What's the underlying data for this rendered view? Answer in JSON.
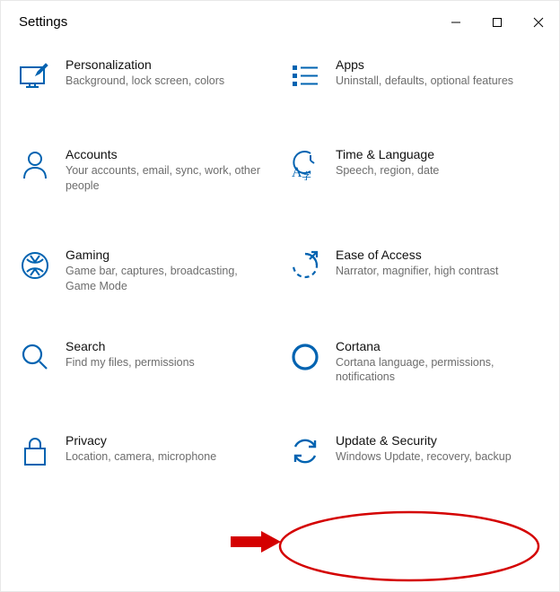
{
  "window": {
    "title": "Settings"
  },
  "colors": {
    "accent": "#0063B1",
    "annotation": "#d40000"
  },
  "tiles": [
    {
      "key": "personalization",
      "icon": "personalization-icon",
      "title": "Personalization",
      "desc": "Background, lock screen, colors"
    },
    {
      "key": "apps",
      "icon": "apps-icon",
      "title": "Apps",
      "desc": "Uninstall, defaults, optional features"
    },
    {
      "key": "accounts",
      "icon": "accounts-icon",
      "title": "Accounts",
      "desc": "Your accounts, email, sync, work, other people"
    },
    {
      "key": "time-language",
      "icon": "time-language-icon",
      "title": "Time & Language",
      "desc": "Speech, region, date"
    },
    {
      "key": "gaming",
      "icon": "gaming-icon",
      "title": "Gaming",
      "desc": "Game bar, captures, broadcasting, Game Mode"
    },
    {
      "key": "ease-of-access",
      "icon": "ease-of-access-icon",
      "title": "Ease of Access",
      "desc": "Narrator, magnifier, high contrast"
    },
    {
      "key": "search",
      "icon": "search-icon",
      "title": "Search",
      "desc": "Find my files, permissions"
    },
    {
      "key": "cortana",
      "icon": "cortana-icon",
      "title": "Cortana",
      "desc": "Cortana language, permissions, notifications"
    },
    {
      "key": "privacy",
      "icon": "privacy-icon",
      "title": "Privacy",
      "desc": "Location, camera, microphone"
    },
    {
      "key": "update-security",
      "icon": "update-security-icon",
      "title": "Update & Security",
      "desc": "Windows Update, recovery, backup"
    }
  ]
}
